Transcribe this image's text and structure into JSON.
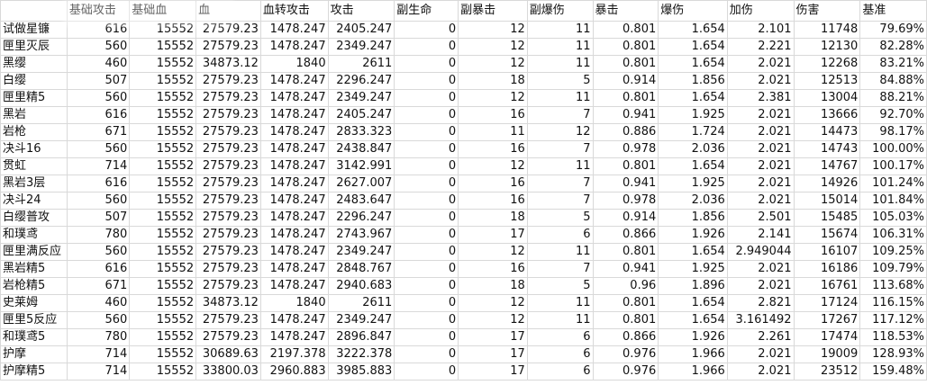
{
  "headers": [
    "",
    "基础攻击",
    "基础血",
    "血",
    "血转攻击",
    "攻击",
    "副生命",
    "副暴击",
    "副爆伤",
    "暴击",
    "爆伤",
    "加伤",
    "伤害",
    "基准"
  ],
  "rows": [
    [
      "试做星镰",
      "616",
      "15552",
      "27579.23",
      "1478.247",
      "2405.247",
      "0",
      "12",
      "11",
      "0.801",
      "1.654",
      "2.101",
      "11748",
      "79.69%"
    ],
    [
      "匣里灭辰",
      "560",
      "15552",
      "27579.23",
      "1478.247",
      "2349.247",
      "0",
      "12",
      "11",
      "0.801",
      "1.654",
      "2.221",
      "12130",
      "82.28%"
    ],
    [
      "黑缨",
      "460",
      "15552",
      "34873.12",
      "1840",
      "2611",
      "0",
      "12",
      "11",
      "0.801",
      "1.654",
      "2.021",
      "12268",
      "83.21%"
    ],
    [
      "白缨",
      "507",
      "15552",
      "27579.23",
      "1478.247",
      "2296.247",
      "0",
      "18",
      "5",
      "0.914",
      "1.856",
      "2.021",
      "12513",
      "84.88%"
    ],
    [
      "匣里精5",
      "560",
      "15552",
      "27579.23",
      "1478.247",
      "2349.247",
      "0",
      "12",
      "11",
      "0.801",
      "1.654",
      "2.381",
      "13004",
      "88.21%"
    ],
    [
      "黑岩",
      "616",
      "15552",
      "27579.23",
      "1478.247",
      "2405.247",
      "0",
      "16",
      "7",
      "0.941",
      "1.925",
      "2.021",
      "13666",
      "92.70%"
    ],
    [
      "岩枪",
      "671",
      "15552",
      "27579.23",
      "1478.247",
      "2833.323",
      "0",
      "11",
      "12",
      "0.886",
      "1.724",
      "2.021",
      "14473",
      "98.17%"
    ],
    [
      "决斗16",
      "560",
      "15552",
      "27579.23",
      "1478.247",
      "2438.847",
      "0",
      "16",
      "7",
      "0.978",
      "2.036",
      "2.021",
      "14743",
      "100.00%"
    ],
    [
      "贯虹",
      "714",
      "15552",
      "27579.23",
      "1478.247",
      "3142.991",
      "0",
      "12",
      "11",
      "0.801",
      "1.654",
      "2.021",
      "14767",
      "100.17%"
    ],
    [
      "黑岩3层",
      "616",
      "15552",
      "27579.23",
      "1478.247",
      "2627.007",
      "0",
      "16",
      "7",
      "0.941",
      "1.925",
      "2.021",
      "14926",
      "101.24%"
    ],
    [
      "决斗24",
      "560",
      "15552",
      "27579.23",
      "1478.247",
      "2483.647",
      "0",
      "16",
      "7",
      "0.978",
      "2.036",
      "2.021",
      "15014",
      "101.84%"
    ],
    [
      "白缨普攻",
      "507",
      "15552",
      "27579.23",
      "1478.247",
      "2296.247",
      "0",
      "18",
      "5",
      "0.914",
      "1.856",
      "2.501",
      "15485",
      "105.03%"
    ],
    [
      "和璞鸢",
      "780",
      "15552",
      "27579.23",
      "1478.247",
      "2743.967",
      "0",
      "17",
      "6",
      "0.866",
      "1.926",
      "2.141",
      "15674",
      "106.31%"
    ],
    [
      "匣里满反应",
      "560",
      "15552",
      "27579.23",
      "1478.247",
      "2349.247",
      "0",
      "12",
      "11",
      "0.801",
      "1.654",
      "2.949044",
      "16107",
      "109.25%"
    ],
    [
      "黑岩精5",
      "616",
      "15552",
      "27579.23",
      "1478.247",
      "2848.767",
      "0",
      "16",
      "7",
      "0.941",
      "1.925",
      "2.021",
      "16186",
      "109.79%"
    ],
    [
      "岩枪精5",
      "671",
      "15552",
      "27579.23",
      "1478.247",
      "2940.683",
      "0",
      "18",
      "5",
      "0.96",
      "1.896",
      "2.021",
      "16761",
      "113.68%"
    ],
    [
      "史莱姆",
      "460",
      "15552",
      "34873.12",
      "1840",
      "2611",
      "0",
      "12",
      "11",
      "0.801",
      "1.654",
      "2.821",
      "17124",
      "116.15%"
    ],
    [
      "匣里5反应",
      "560",
      "15552",
      "27579.23",
      "1478.247",
      "2349.247",
      "0",
      "12",
      "11",
      "0.801",
      "1.654",
      "3.161492",
      "17267",
      "117.12%"
    ],
    [
      "和璞鸢5",
      "780",
      "15552",
      "27579.23",
      "1478.247",
      "2896.847",
      "0",
      "17",
      "6",
      "0.866",
      "1.926",
      "2.261",
      "17474",
      "118.53%"
    ],
    [
      "护摩",
      "714",
      "15552",
      "30689.63",
      "2197.378",
      "3222.378",
      "0",
      "17",
      "6",
      "0.976",
      "1.966",
      "2.021",
      "19009",
      "128.93%"
    ],
    [
      "护摩精5",
      "714",
      "15552",
      "33800.03",
      "2960.883",
      "3985.883",
      "0",
      "17",
      "6",
      "0.976",
      "1.966",
      "2.021",
      "23512",
      "159.48%"
    ]
  ]
}
